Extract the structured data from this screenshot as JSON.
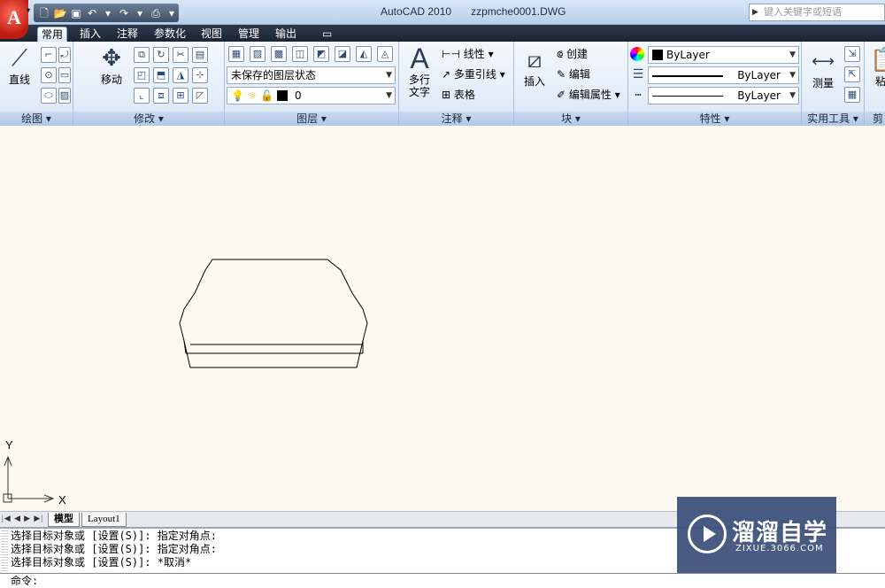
{
  "app": {
    "logo": "A",
    "title": "AutoCAD 2010",
    "document": "zzpmche0001.DWG",
    "search_placeholder": "键入关键字或短语"
  },
  "quick_access": [
    "new-icon",
    "open-icon",
    "save-icon",
    "undo-icon",
    "redo-icon",
    "plot-icon",
    "dropdown-icon"
  ],
  "tabs": [
    {
      "label": "常用",
      "active": true
    },
    {
      "label": "插入"
    },
    {
      "label": "注释"
    },
    {
      "label": "参数化"
    },
    {
      "label": "视图"
    },
    {
      "label": "管理"
    },
    {
      "label": "输出"
    },
    {
      "label": "▭"
    }
  ],
  "ribbon": {
    "draw": {
      "line": "直线",
      "label": "绘图 ▾"
    },
    "modify": {
      "move": "移动",
      "label": "修改 ▾"
    },
    "layers": {
      "state": "未保存的图层状态",
      "current": "0",
      "label": "图层 ▾"
    },
    "annotation": {
      "mtext": "多行",
      "mtext2": "文字",
      "linear": "线性",
      "mleader": "多重引线",
      "table": "表格",
      "label": "注释 ▾"
    },
    "block": {
      "insert": "插入",
      "create": "创建",
      "edit": "编辑",
      "edit_attr": "编辑属性",
      "label": "块 ▾"
    },
    "properties": {
      "color": "ByLayer",
      "linetype": "ByLayer",
      "lineweight": "ByLayer",
      "label": "特性 ▾"
    },
    "utilities": {
      "measure": "测量",
      "label": "实用工具 ▾"
    },
    "clipboard": {
      "paste": "粘",
      "label": "剪"
    }
  },
  "ucs": {
    "x": "X",
    "y": "Y"
  },
  "layout_tabs": [
    "模型",
    "Layout1"
  ],
  "command": {
    "lines": [
      "选择目标对象或 [设置(S)]: 指定对角点:",
      "选择目标对象或 [设置(S)]: 指定对角点:",
      "选择目标对象或 [设置(S)]: *取消*"
    ],
    "prompt": "命令:"
  },
  "watermark": {
    "title": "溜溜自学",
    "sub": "ZIXUE.3066.COM"
  }
}
